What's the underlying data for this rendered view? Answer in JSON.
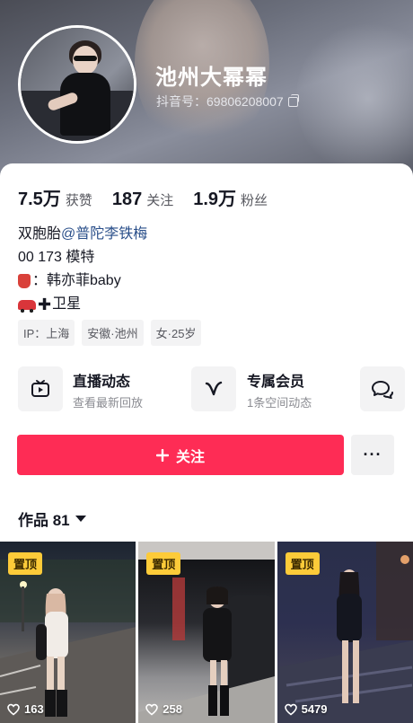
{
  "profile": {
    "name": "池州大幂幂",
    "douyin_id_label": "抖音号：",
    "douyin_id": "69806208007"
  },
  "stats": [
    {
      "num": "7.5万",
      "label": "获赞"
    },
    {
      "num": "187",
      "label": "关注"
    },
    {
      "num": "1.9万",
      "label": "粉丝"
    }
  ],
  "bio": {
    "line1_text": "双胞胎",
    "line1_mention": "@普陀李铁梅",
    "line2": "00 173 模特",
    "line3": "：韩亦菲baby",
    "line4": "卫星"
  },
  "tags": [
    "IP：上海",
    "安徽·池州",
    "女·25岁"
  ],
  "cards": [
    {
      "title": "直播动态",
      "subtitle": "查看最新回放"
    },
    {
      "title": "专属会员",
      "subtitle": "1条空间动态"
    }
  ],
  "actions": {
    "follow_label": "关注",
    "more_label": "···"
  },
  "works": {
    "label": "作品 81",
    "items": [
      {
        "pin": "置顶",
        "likes": "163"
      },
      {
        "pin": "置顶",
        "likes": "258"
      },
      {
        "pin": "置顶",
        "likes": "5479"
      }
    ]
  }
}
